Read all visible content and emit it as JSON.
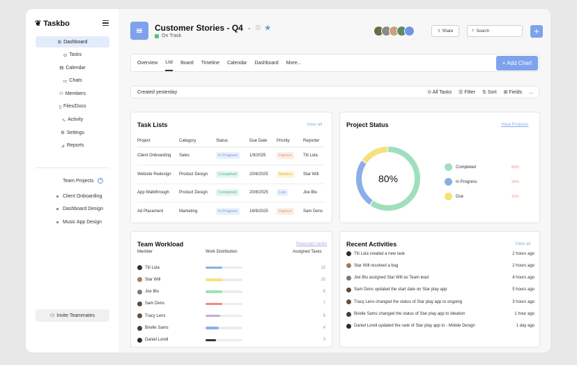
{
  "app": {
    "name": "Taskbo"
  },
  "sidebar": {
    "items": [
      {
        "label": "Dashboard",
        "icon": "grid-icon"
      },
      {
        "label": "Tasks",
        "icon": "check-circle-icon"
      },
      {
        "label": "Calendar",
        "icon": "calendar-icon"
      },
      {
        "label": "Chats",
        "icon": "chat-icon"
      },
      {
        "label": "Members",
        "icon": "members-icon"
      },
      {
        "label": "Files/Docs",
        "icon": "file-icon"
      },
      {
        "label": "Activity",
        "icon": "activity-icon"
      },
      {
        "label": "Settings",
        "icon": "gear-icon"
      },
      {
        "label": "Reports",
        "icon": "reports-icon"
      }
    ],
    "team_projects_label": "Team Projects",
    "team_projects": [
      "Client Onboarding",
      "Dashboard Design",
      "Music App Design"
    ],
    "invite_label": "Invite Teammates"
  },
  "header": {
    "title": "Customer Stories - Q4",
    "status": "On Track",
    "share_label": "Share",
    "search_placeholder": "Search"
  },
  "tabs": [
    "Overview",
    "List",
    "Board",
    "Timeline",
    "Calendar",
    "Dashboard",
    "More..."
  ],
  "add_chart_label": "+ Add Chart",
  "filter_bar": {
    "created": "Created yesterday",
    "all_tasks": "All Tasks",
    "filter": "Filter",
    "sort": "Sort",
    "fields": "Fields",
    "more": "..."
  },
  "task_lists": {
    "title": "Task Lists",
    "view_all": "View all",
    "columns": [
      "Project",
      "Category",
      "Status",
      "Due Date",
      "Priority",
      "Reporter"
    ],
    "rows": [
      {
        "project": "Client Onboarding",
        "category": "Sales",
        "status": "In Progress",
        "due": "1/9/2025",
        "priority": "Highest",
        "reporter": "Titi Lola"
      },
      {
        "project": "Website Redesign",
        "category": "Product Design",
        "status": "Completed",
        "due": "20/8/2025",
        "priority": "Medium",
        "reporter": "Star Will"
      },
      {
        "project": "App Walkthrough",
        "category": "Product Design",
        "status": "Completed",
        "due": "20/8/2025",
        "priority": "Low",
        "reporter": "Joe Blu"
      },
      {
        "project": "Ad Placement",
        "category": "Marketing",
        "status": "In Progress",
        "due": "16/9/2025",
        "priority": "Highest",
        "reporter": "Sam Dens"
      }
    ]
  },
  "project_status": {
    "title": "Project Status",
    "view_link": "View Projects",
    "center_label": "80%",
    "legend": [
      {
        "label": "Completed",
        "pct": "60%",
        "color": "#9fdfbd",
        "value": 0.6
      },
      {
        "label": "In Progress",
        "pct": "25%",
        "color": "#8aaee8",
        "value": 0.25
      },
      {
        "label": "Due",
        "pct": "15%",
        "color": "#f5e27a",
        "value": 0.15
      }
    ]
  },
  "team_workload": {
    "title": "Team Workload",
    "reassign": "Reassign tasks",
    "col_member": "Member",
    "col_distribution": "Work Distribution",
    "col_assigned": "Assigned Tasks",
    "rows": [
      {
        "name": "Titi Lola",
        "count": "15",
        "fill": 0.45,
        "color": "#8aaee8"
      },
      {
        "name": "Star Will",
        "count": "10",
        "fill": 0.45,
        "color": "#f5e27a"
      },
      {
        "name": "Joe Blu",
        "count": "8",
        "fill": 0.45,
        "color": "#9fdfbd"
      },
      {
        "name": "Sam Dens",
        "count": "7",
        "fill": 0.45,
        "color": "#ec8a86"
      },
      {
        "name": "Tracy Lens",
        "count": "6",
        "fill": 0.4,
        "color": "#c3a8e3"
      },
      {
        "name": "Brielle Sams",
        "count": "4",
        "fill": 0.35,
        "color": "#8aaee8"
      },
      {
        "name": "Daniel Lorell",
        "count": "3",
        "fill": 0.28,
        "color": "#333333"
      }
    ]
  },
  "recent_activities": {
    "title": "Recent Activities",
    "view_all": "View all",
    "rows": [
      {
        "text": "Titi Lola created a new task",
        "time": "2 hours ago"
      },
      {
        "text": "Star Will resolved a bug",
        "time": "2 hours ago"
      },
      {
        "text": "Joe Blu assigned Star Will as Team lead",
        "time": "4 hours ago"
      },
      {
        "text": "Sam Dens updated the start date on Star play app",
        "time": "5 hours ago"
      },
      {
        "text": "Tracy Lens changed the status of Star play app to ongoing",
        "time": "3 hours ago"
      },
      {
        "text": "Brielle Sams changed the status of Star play app to Ideation",
        "time": "1 hour ago"
      },
      {
        "text": "Daniel Lorell updated the rank of Star play app to - Mobile Design",
        "time": "1 day ago"
      }
    ]
  }
}
